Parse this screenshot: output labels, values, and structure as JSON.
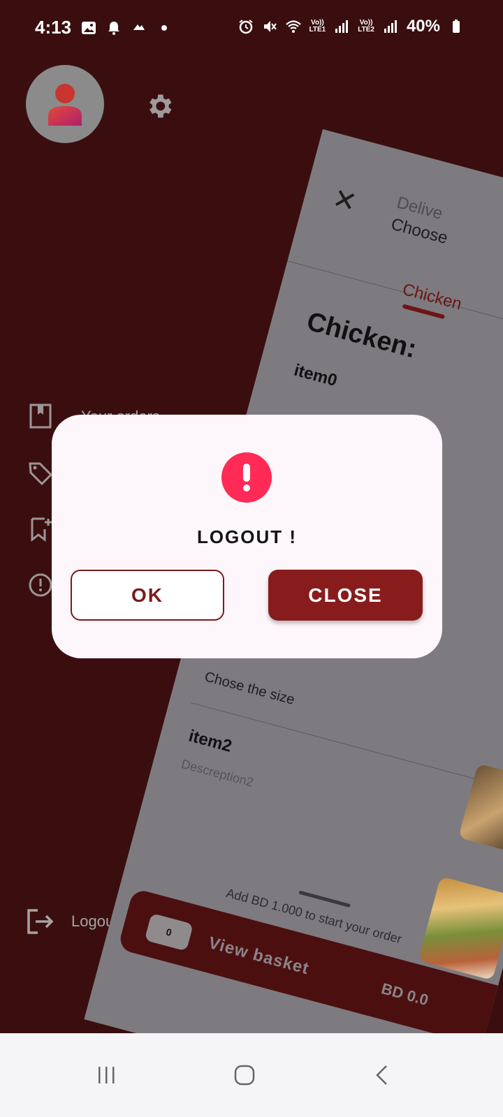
{
  "status_bar": {
    "time": "4:13",
    "battery": "40%",
    "sim1_label": "LTE1",
    "sim2_label": "LTE2",
    "volte": "Vo))"
  },
  "drawer": {
    "menu_items": [
      {
        "icon": "bookmark-book-icon",
        "label": "Your orders"
      },
      {
        "icon": "tag-icon",
        "label": ""
      },
      {
        "icon": "bookmark-add-icon",
        "label": ""
      },
      {
        "icon": "info-icon",
        "label": ""
      }
    ],
    "logout_label": "Logout"
  },
  "preview": {
    "header_line1": "Delive",
    "header_line2": "Choose",
    "tab_label": "Chicken",
    "section_title": "Chicken:",
    "item0": "item0",
    "chose_size": "Chose the size",
    "item2": "item2",
    "desc2": "Descreption2",
    "add_notice": "Add BD 1.000 to start your order",
    "basket_count": "0",
    "basket_label": "View basket",
    "basket_price": "BD 0.0"
  },
  "dialog": {
    "title": "LOGOUT !",
    "ok_label": "OK",
    "close_label": "CLOSE",
    "accent": "#881c1d",
    "alert_color": "#ff2a55"
  },
  "colors": {
    "background": "#3a0e0f",
    "dialog_bg": "#fdf6fa"
  }
}
